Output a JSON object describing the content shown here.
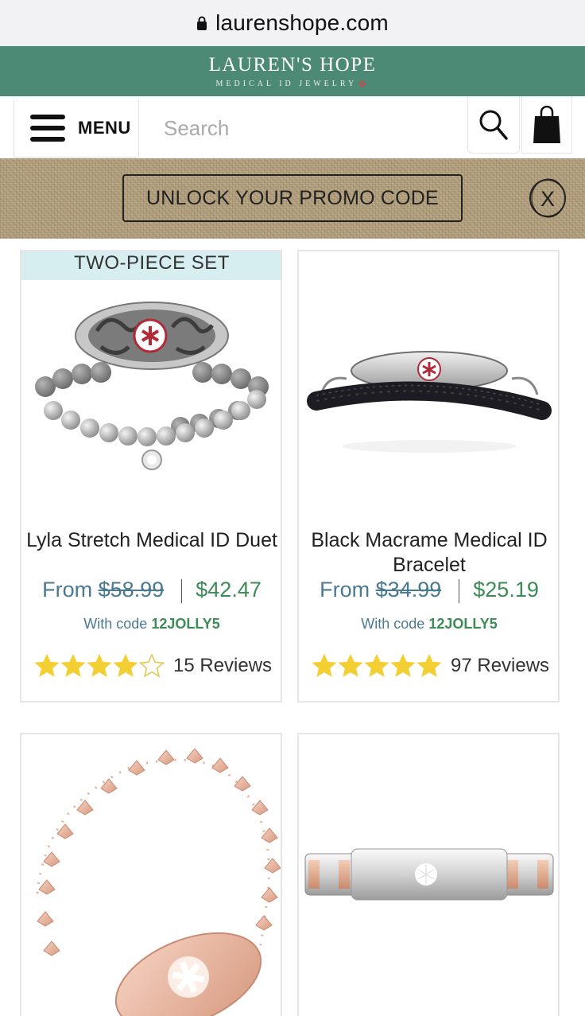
{
  "browser": {
    "url": "laurenshope.com"
  },
  "brand": {
    "name": "LAUREN'S HOPE",
    "tagline": "MEDICAL ID JEWELRY"
  },
  "nav": {
    "menu_label": "MENU",
    "search_placeholder": "Search"
  },
  "promo": {
    "label": "UNLOCK YOUR PROMO CODE",
    "close_label": "X"
  },
  "products": [
    {
      "ribbon": "TWO-PIECE SET",
      "title": "Lyla Stretch Medical ID Duet",
      "from": "From",
      "old_price": "$58.99",
      "price": "$42.47",
      "code_prefix": "With code",
      "code": "12JOLLY5",
      "rating": 4,
      "reviews": "15 Reviews"
    },
    {
      "title": "Black Macrame Medical ID Bracelet",
      "from": "From",
      "old_price": "$34.99",
      "price": "$25.19",
      "code_prefix": "With code",
      "code": "12JOLLY5",
      "rating": 5,
      "reviews": "97 Reviews"
    },
    {
      "image": "rose-gold-heart-chain-bracelet"
    },
    {
      "image": "stainless-rose-gold-link-bracelet"
    }
  ],
  "colors": {
    "brand_green": "#4d8a76",
    "price_green": "#3d8b57",
    "price_blue": "#4a7a92",
    "star_yellow": "#f4cf33"
  }
}
